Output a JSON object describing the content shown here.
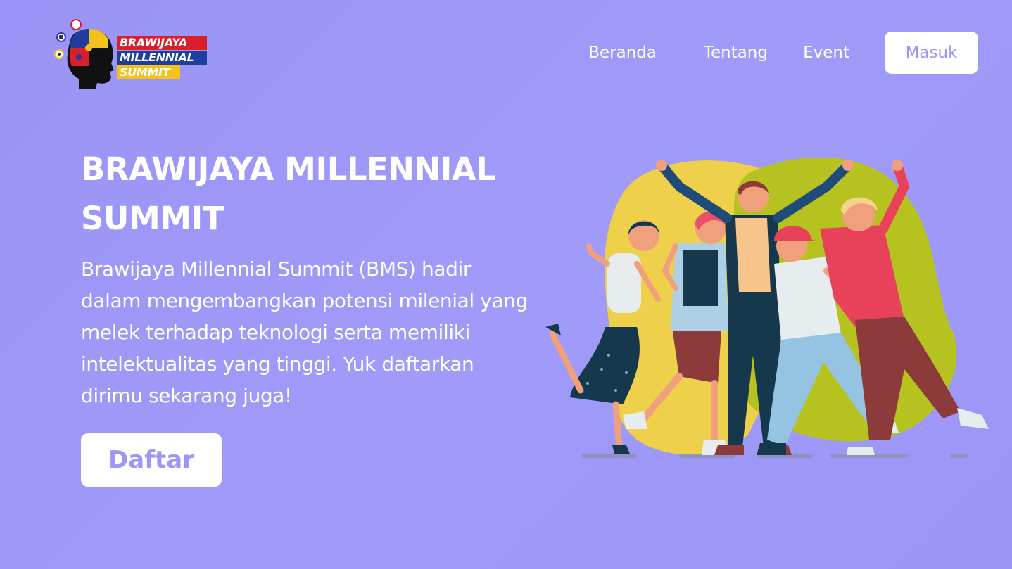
{
  "header": {
    "logo": {
      "line1": "BRAWIJAYA",
      "line2": "MILLENNIAL",
      "line3": "SUMMIT"
    },
    "nav": [
      {
        "label": "Beranda"
      },
      {
        "label": "Tentang"
      },
      {
        "label": "Event"
      }
    ],
    "login_label": "Masuk"
  },
  "hero": {
    "title": "BRAWIJAYA MILLENNIAL SUMMIT",
    "description": "Brawijaya Millennial Summit (BMS) hadir dalam mengembangkan potensi milenial yang melek terhadap teknologi serta memiliki intelektualitas yang tinggi. Yuk daftarkan dirimu sekarang juga!",
    "cta_label": "Daftar"
  },
  "colors": {
    "background": "#9c97f7",
    "accent": "#9c97f5",
    "logo_red": "#d9202a",
    "logo_blue": "#1f3d9e",
    "logo_yellow": "#f4c21a"
  },
  "icons": [
    "brain-puzzle-head-icon",
    "group-of-friends-illustration"
  ]
}
